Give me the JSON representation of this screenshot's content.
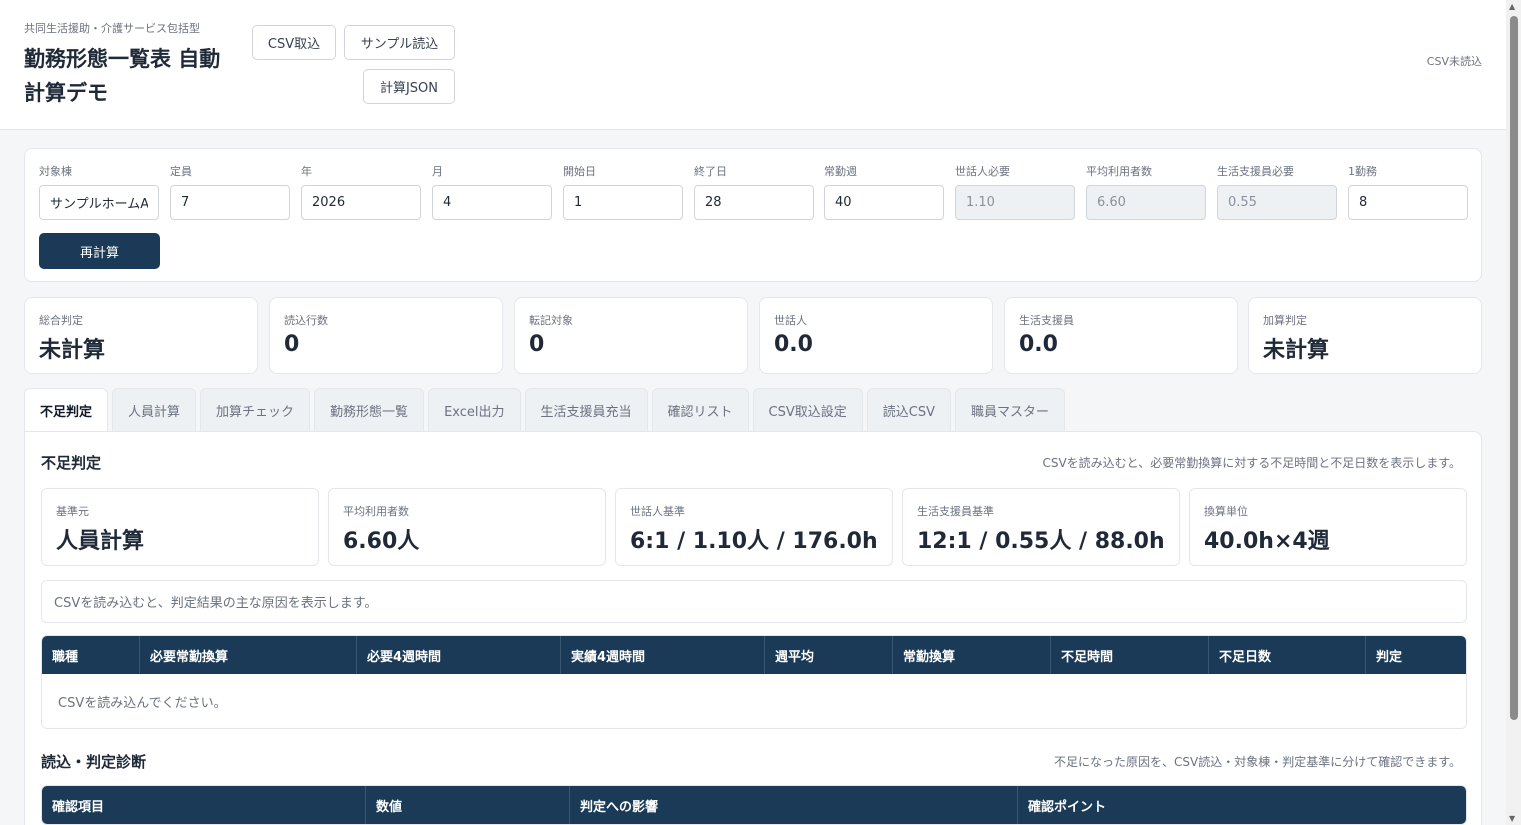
{
  "header": {
    "subtitle": "共同生活援助・介護サービス包括型",
    "title": "勤務形態一覧表 自動計算デモ",
    "buttons": {
      "csv_import": "CSV取込",
      "sample_load": "サンプル読込",
      "calc_json": "計算JSON"
    },
    "csv_status": "CSV未読込"
  },
  "params": {
    "fields": [
      {
        "label": "対象棟",
        "value": "サンプルホームA"
      },
      {
        "label": "定員",
        "value": "7"
      },
      {
        "label": "年",
        "value": "2026"
      },
      {
        "label": "月",
        "value": "4"
      },
      {
        "label": "開始日",
        "value": "1"
      },
      {
        "label": "終了日",
        "value": "28"
      },
      {
        "label": "常勤週",
        "value": "40"
      },
      {
        "label": "世話人必要",
        "value": "1.10"
      },
      {
        "label": "平均利用者数",
        "value": "6.60"
      },
      {
        "label": "生活支援員必要",
        "value": "0.55"
      },
      {
        "label": "1勤務",
        "value": "8"
      }
    ],
    "recalc_label": "再計算"
  },
  "stats": [
    {
      "label": "総合判定",
      "value": "未計算"
    },
    {
      "label": "読込行数",
      "value": "0"
    },
    {
      "label": "転記対象",
      "value": "0"
    },
    {
      "label": "世話人",
      "value": "0.0"
    },
    {
      "label": "生活支援員",
      "value": "0.0"
    },
    {
      "label": "加算判定",
      "value": "未計算"
    }
  ],
  "tabs": [
    "不足判定",
    "人員計算",
    "加算チェック",
    "勤務形態一覧",
    "Excel出力",
    "生活支援員充当",
    "確認リスト",
    "CSV取込設定",
    "読込CSV",
    "職員マスター"
  ],
  "active_tab": "不足判定",
  "shortage": {
    "title": "不足判定",
    "note": "CSVを読み込むと、必要常勤換算に対する不足時間と不足日数を表示します。",
    "cards": [
      {
        "label": "基準元",
        "value": "人員計算"
      },
      {
        "label": "平均利用者数",
        "value": "6.60人"
      },
      {
        "label": "世話人基準",
        "value": "6:1 / 1.10人 / 176.0h"
      },
      {
        "label": "生活支援員基準",
        "value": "12:1 / 0.55人 / 88.0h"
      },
      {
        "label": "換算単位",
        "value": "40.0h×4週"
      }
    ],
    "cause_text": "CSVを読み込むと、判定結果の主な原因を表示します。",
    "table_headers": [
      "職種",
      "必要常勤換算",
      "必要4週時間",
      "実績4週時間",
      "週平均",
      "常勤換算",
      "不足時間",
      "不足日数",
      "判定"
    ],
    "empty_text": "CSVを読み込んでください。"
  },
  "diagnosis": {
    "title": "読込・判定診断",
    "note": "不足になった原因を、CSV読込・対象棟・判定基準に分けて確認できます。",
    "table_headers": [
      "確認項目",
      "数値",
      "判定への影響",
      "確認ポイント"
    ]
  }
}
